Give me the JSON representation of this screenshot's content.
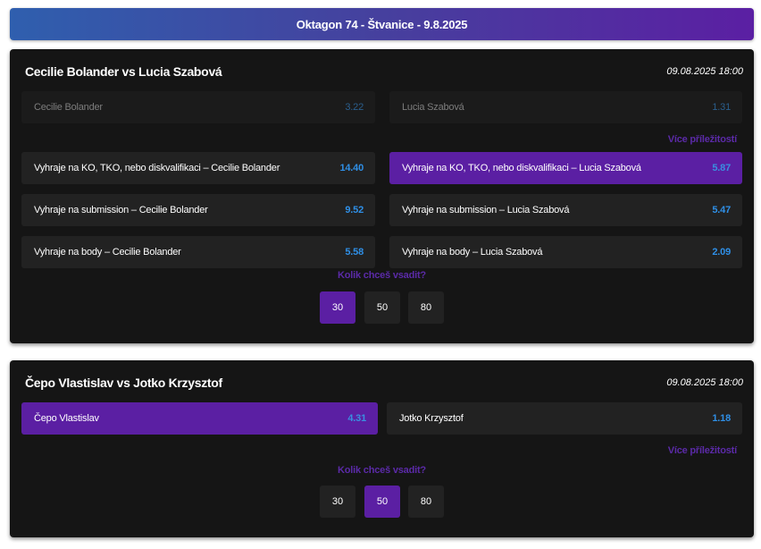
{
  "banner": {
    "title": "Oktagon 74 - Štvanice - 9.8.2025"
  },
  "matches": [
    {
      "title": "Cecilie Bolander vs Lucia Szabová",
      "date": "09.08.2025 18:00",
      "main": [
        {
          "label": "Cecilie Bolander",
          "odd": "3.22",
          "state": "dim"
        },
        {
          "label": "Lucia Szabová",
          "odd": "1.31",
          "state": "dim"
        }
      ],
      "more_label": "Více příležitostí",
      "extra": [
        {
          "label": "Vyhraje na KO, TKO, nebo diskvalifikaci – Cecilie Bolander",
          "odd": "14.40",
          "state": "normal"
        },
        {
          "label": "Vyhraje na KO, TKO, nebo diskvalifikaci – Lucia Szabová",
          "odd": "5.87",
          "state": "selected"
        },
        {
          "label": "Vyhraje na submission – Cecilie Bolander",
          "odd": "9.52",
          "state": "normal"
        },
        {
          "label": "Vyhraje na submission – Lucia Szabová",
          "odd": "5.47",
          "state": "normal"
        },
        {
          "label": "Vyhraje na body – Cecilie Bolander",
          "odd": "5.58",
          "state": "normal"
        },
        {
          "label": "Vyhraje na body – Lucia Szabová",
          "odd": "2.09",
          "state": "normal"
        }
      ],
      "stake_question": "Kolik chceš vsadit?",
      "stakes": [
        "30",
        "50",
        "80"
      ],
      "selected_stake": "30"
    },
    {
      "title": "Čepo Vlastislav vs Jotko Krzysztof",
      "date": "09.08.2025 18:00",
      "main": [
        {
          "label": "Čepo Vlastislav",
          "odd": "4.31",
          "state": "selected"
        },
        {
          "label": "Jotko Krzysztof",
          "odd": "1.18",
          "state": "normal"
        }
      ],
      "more_label": "Více příležitostí",
      "stake_question": "Kolik chceš vsadit?",
      "stakes": [
        "30",
        "50",
        "80"
      ],
      "selected_stake": "50"
    }
  ],
  "colors": {
    "accent": "#5b1fa3",
    "odd_value": "#2f8fe6",
    "card_bg": "#151515",
    "button_bg": "#222222"
  }
}
